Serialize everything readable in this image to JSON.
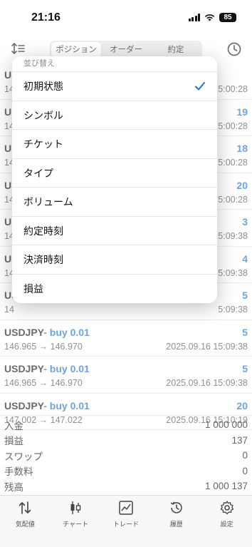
{
  "status_bar": {
    "time": "21:16",
    "battery": "85"
  },
  "segments": [
    {
      "label": "ポジション",
      "active": true
    },
    {
      "label": "オーダー",
      "active": false
    },
    {
      "label": "約定",
      "active": false
    }
  ],
  "positions": [
    {
      "symbol": "USDJPY",
      "side": "",
      "profit": "",
      "prices": "14",
      "time": "5:00:28"
    },
    {
      "symbol": "USD",
      "side": "",
      "profit": "19",
      "prices": "14",
      "time": "5:00:28"
    },
    {
      "symbol": "USD",
      "side": "",
      "profit": "18",
      "prices": "14",
      "time": "5:00:28"
    },
    {
      "symbol": "USD",
      "side": "",
      "profit": "20",
      "prices": "14",
      "time": "5:00:28"
    },
    {
      "symbol": "USD",
      "side": "",
      "profit": "3",
      "prices": "14",
      "time": "5:09:38"
    },
    {
      "symbol": "USD",
      "side": "",
      "profit": "4",
      "prices": "14",
      "time": "5:09:38"
    },
    {
      "symbol": "USD",
      "side": "",
      "profit": "5",
      "prices": "14",
      "time": "5:09:38"
    },
    {
      "symbol": "USDJPY",
      "side": "buy 0.01",
      "profit": "5",
      "prices": "146.965 → 146.970",
      "time": "2025.09.16 15:09:38"
    },
    {
      "symbol": "USDJPY",
      "side": "buy 0.01",
      "profit": "5",
      "prices": "146.965 → 146.970",
      "time": "2025.09.16 15:09:38"
    },
    {
      "symbol": "USDJPY",
      "side": "buy 0.01",
      "profit": "20",
      "prices": "147.002 → 147.022",
      "time": "2025.09.16 15:10:19"
    }
  ],
  "summary": [
    {
      "label": "入金",
      "value": "1 000 000"
    },
    {
      "label": "損益",
      "value": "137"
    },
    {
      "label": "スワップ",
      "value": "0"
    },
    {
      "label": "手数料",
      "value": "0"
    },
    {
      "label": "残高",
      "value": "1 000 137"
    }
  ],
  "sort_menu": {
    "header": "並び替え",
    "items": [
      {
        "label": "初期状態",
        "checked": true
      },
      {
        "label": "シンボル"
      },
      {
        "label": "チケット"
      },
      {
        "label": "タイプ"
      },
      {
        "label": "ボリューム"
      },
      {
        "label": "約定時刻"
      },
      {
        "label": "決済時刻"
      },
      {
        "label": "損益"
      }
    ]
  },
  "tabs": [
    {
      "label": "気配値",
      "icon": "quotes-icon"
    },
    {
      "label": "チャート",
      "icon": "chart-icon"
    },
    {
      "label": "トレード",
      "icon": "trade-icon"
    },
    {
      "label": "履歴",
      "icon": "history-icon"
    },
    {
      "label": "設定",
      "icon": "settings-icon"
    }
  ],
  "colors": {
    "accent": "#1b74d6"
  }
}
